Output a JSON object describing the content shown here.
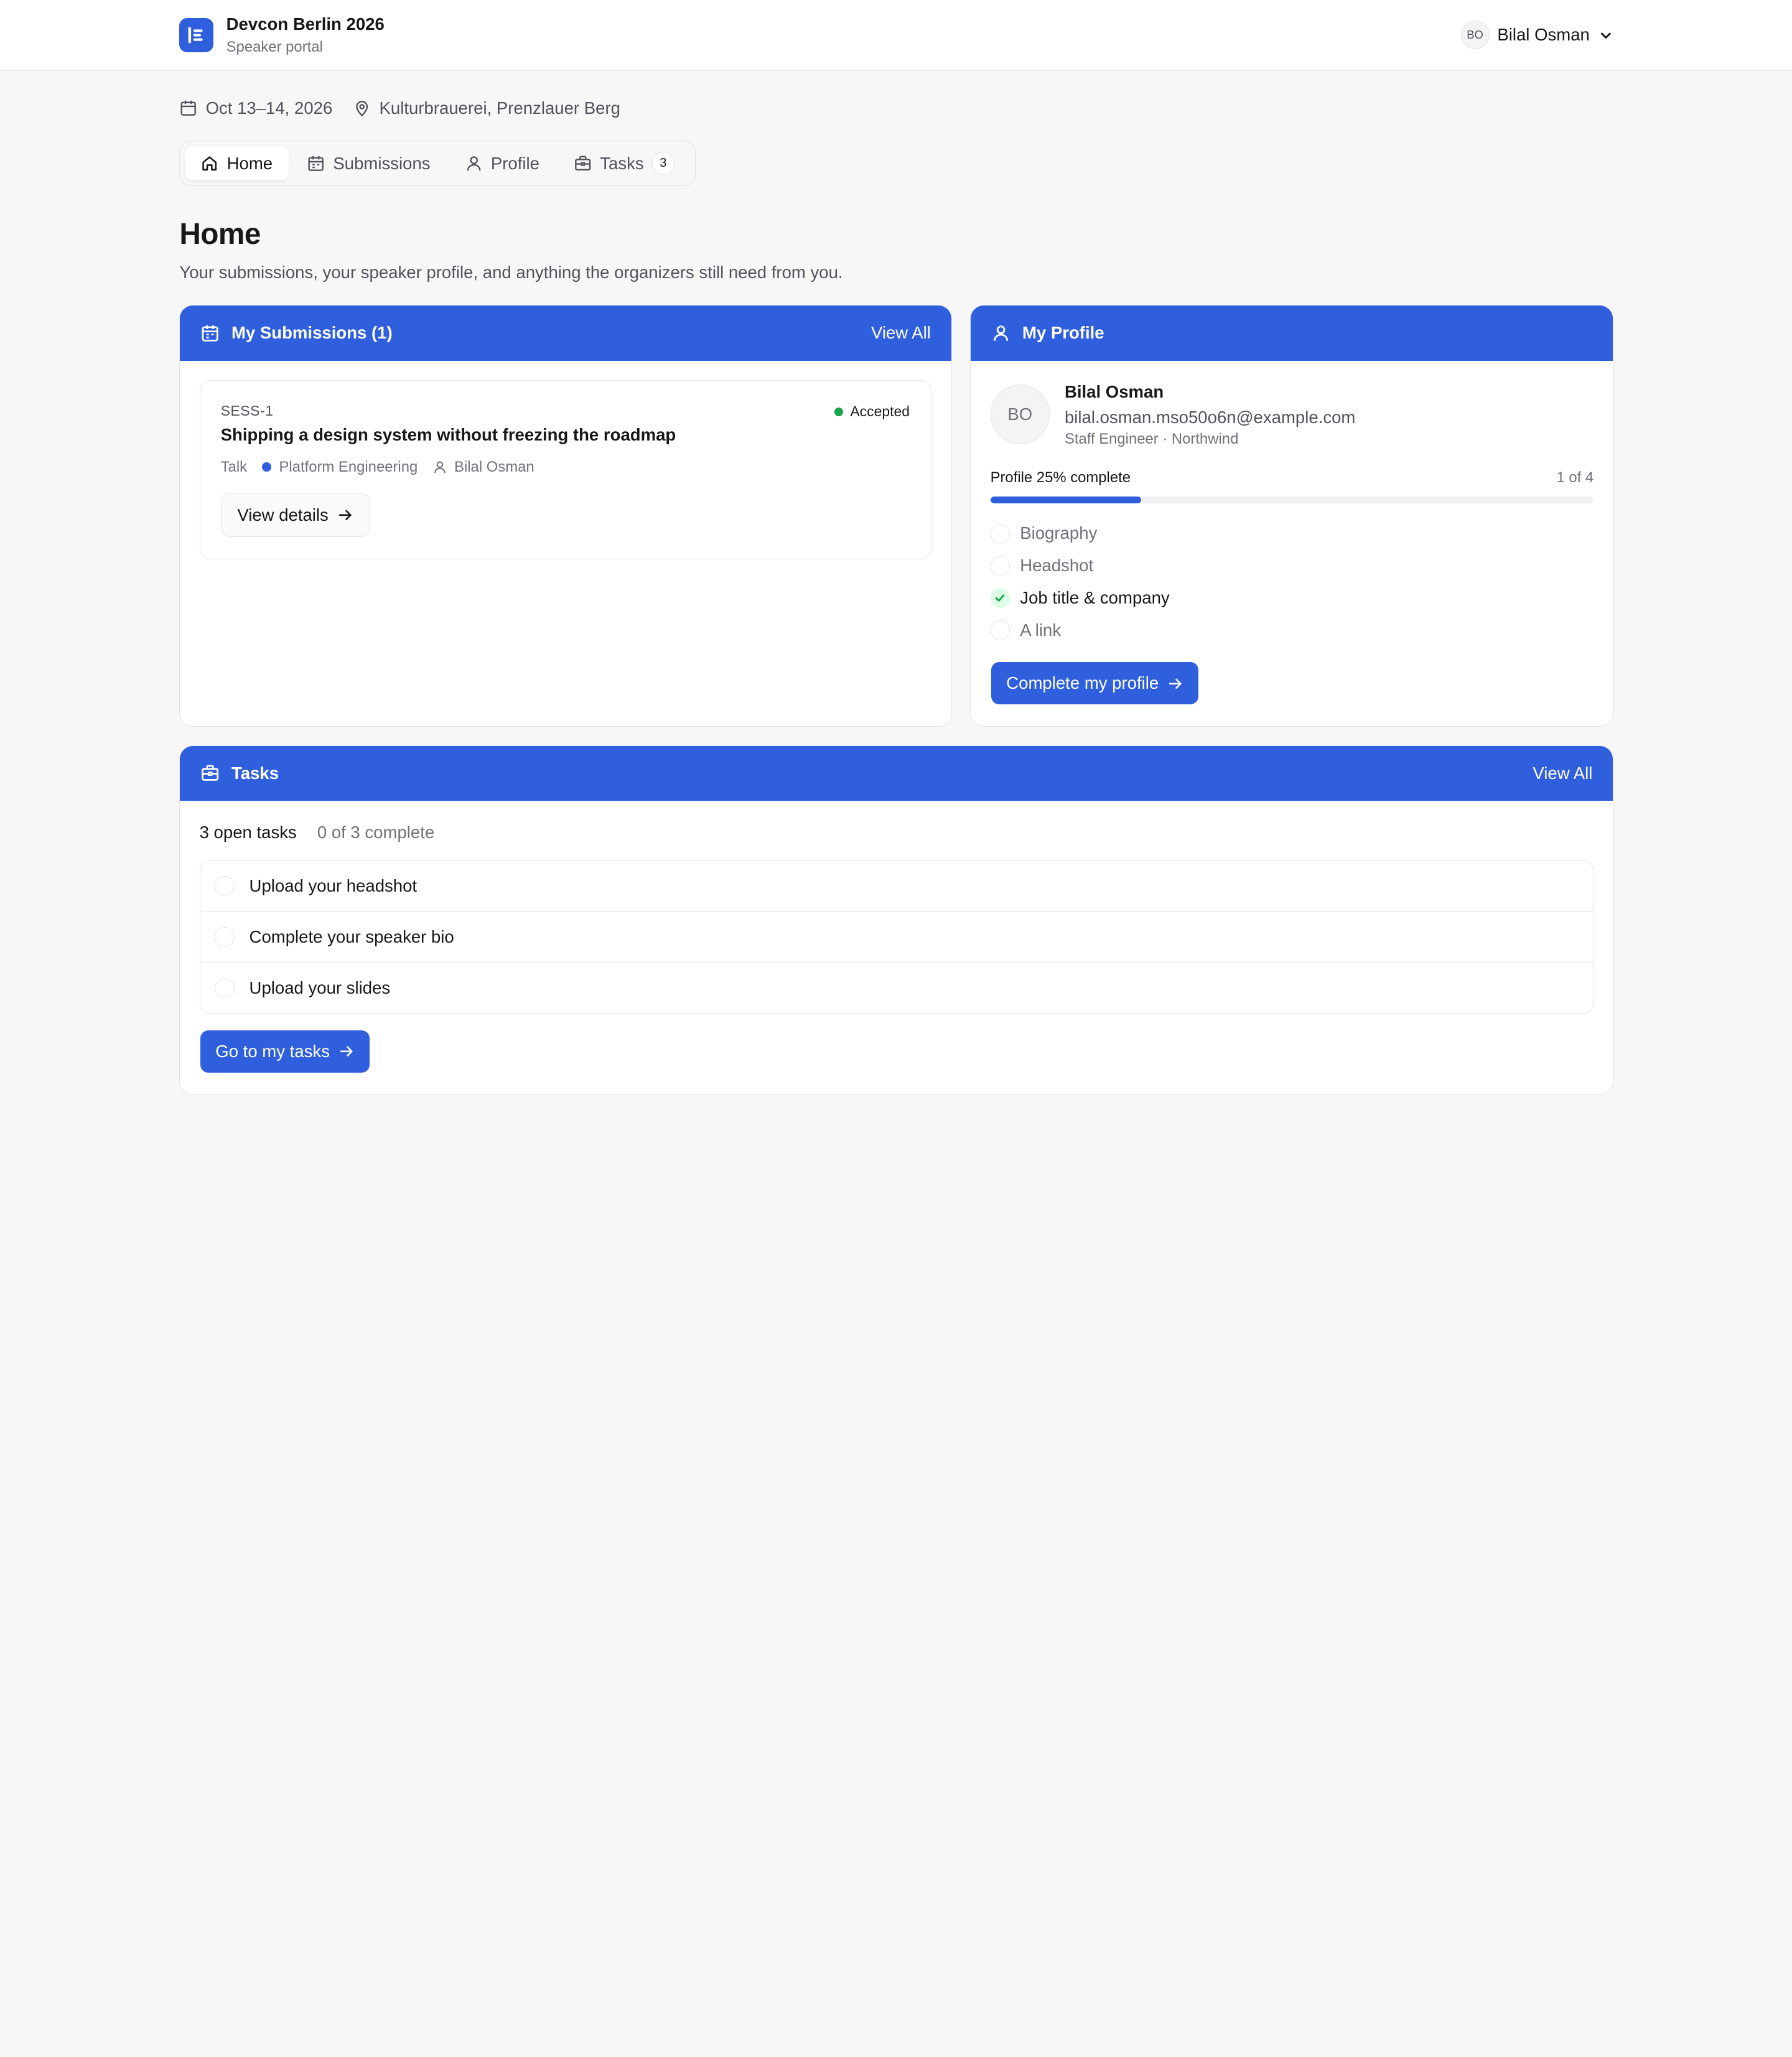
{
  "header": {
    "event_name": "Devcon Berlin 2026",
    "portal_label": "Speaker portal",
    "user": {
      "initials": "BO",
      "name": "Bilal Osman"
    }
  },
  "event_meta": {
    "dates": "Oct 13–14, 2026",
    "venue": "Kulturbrauerei, Prenzlauer Berg"
  },
  "tabs": [
    {
      "label": "Home",
      "icon": "home-icon",
      "active": true
    },
    {
      "label": "Submissions",
      "icon": "calendar-icon"
    },
    {
      "label": "Profile",
      "icon": "user-icon"
    },
    {
      "label": "Tasks",
      "icon": "briefcase-icon",
      "badge": "3"
    }
  ],
  "page": {
    "title": "Home",
    "subtitle": "Your submissions, your speaker profile, and anything the organizers still need from you."
  },
  "submissions_card": {
    "title": "My Submissions (1)",
    "view_all": "View All",
    "items": [
      {
        "code": "SESS-1",
        "title": "Shipping a design system without freezing the roadmap",
        "status": "Accepted",
        "status_color": "#16a34a",
        "type": "Talk",
        "track": "Platform Engineering",
        "track_color": "#2f5fdc",
        "speaker": "Bilal Osman",
        "action": "View details"
      }
    ]
  },
  "profile_card": {
    "title": "My Profile",
    "initials": "BO",
    "name": "Bilal Osman",
    "email": "bilal.osman.mso50o6n@example.com",
    "role": "Staff Engineer · Northwind",
    "progress_label": "Profile 25% complete",
    "progress_count": "1 of 4",
    "progress_fraction": 0.25,
    "checklist": [
      {
        "label": "Biography",
        "done": false
      },
      {
        "label": "Headshot",
        "done": false
      },
      {
        "label": "Job title & company",
        "done": true
      },
      {
        "label": "A link",
        "done": false
      }
    ],
    "cta": "Complete my profile"
  },
  "tasks_card": {
    "title": "Tasks",
    "view_all": "View All",
    "open_summary": "3 open tasks",
    "complete_summary": "0 of 3 complete",
    "items": [
      {
        "label": "Upload your headshot"
      },
      {
        "label": "Complete your speaker bio"
      },
      {
        "label": "Upload your slides"
      }
    ],
    "cta": "Go to my tasks"
  },
  "colors": {
    "accent": "#2f5fdc",
    "success": "#16a34a",
    "background": "#f7f7f8"
  }
}
